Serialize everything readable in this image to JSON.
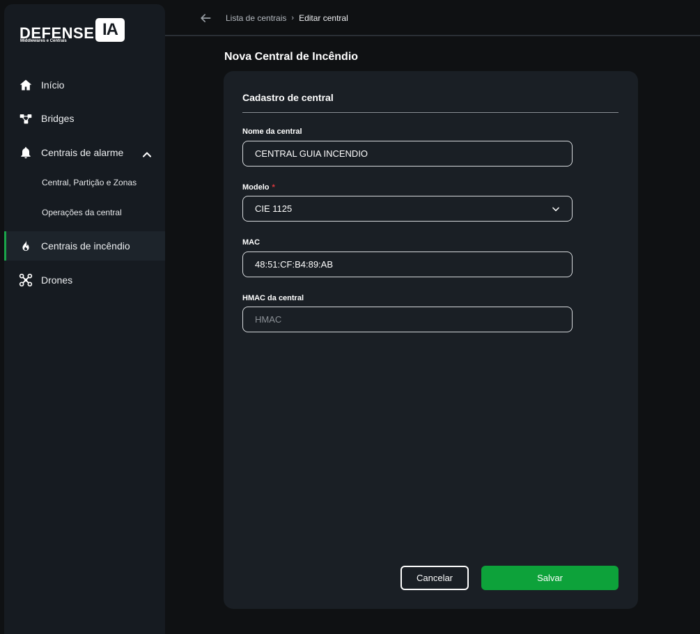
{
  "brand": {
    "name": "DEFENSE",
    "badge": "IA",
    "tagline": "Middlewares e Centrais"
  },
  "sidebar": {
    "items": [
      {
        "label": "Início",
        "icon": "home-icon"
      },
      {
        "label": "Bridges",
        "icon": "bridges-icon"
      },
      {
        "label": "Centrais de alarme",
        "icon": "bell-icon"
      },
      {
        "label": "Central, Partição e Zonas"
      },
      {
        "label": "Operações da central"
      },
      {
        "label": "Centrais de incêndio",
        "icon": "fire-icon",
        "active": true
      },
      {
        "label": "Drones",
        "icon": "drone-icon"
      }
    ]
  },
  "breadcrumb": {
    "parent": "Lista de centrais",
    "current": "Editar central"
  },
  "page": {
    "title": "Nova Central de Incêndio"
  },
  "form": {
    "section_title": "Cadastro de central",
    "nome": {
      "label": "Nome da central",
      "value": "CENTRAL GUIA INCENDIO"
    },
    "modelo": {
      "label": "Modelo",
      "required_mark": "*",
      "value": "CIE 1125"
    },
    "mac": {
      "label": "MAC",
      "value": "48:51:CF:B4:89:AB"
    },
    "hmac": {
      "label": "HMAC da central",
      "placeholder": "HMAC"
    },
    "cancel_label": "Cancelar",
    "save_label": "Salvar"
  },
  "colors": {
    "accent": "#0da23a",
    "required": "#e0383e",
    "background": "#0f1113",
    "card": "#1a1f25"
  }
}
